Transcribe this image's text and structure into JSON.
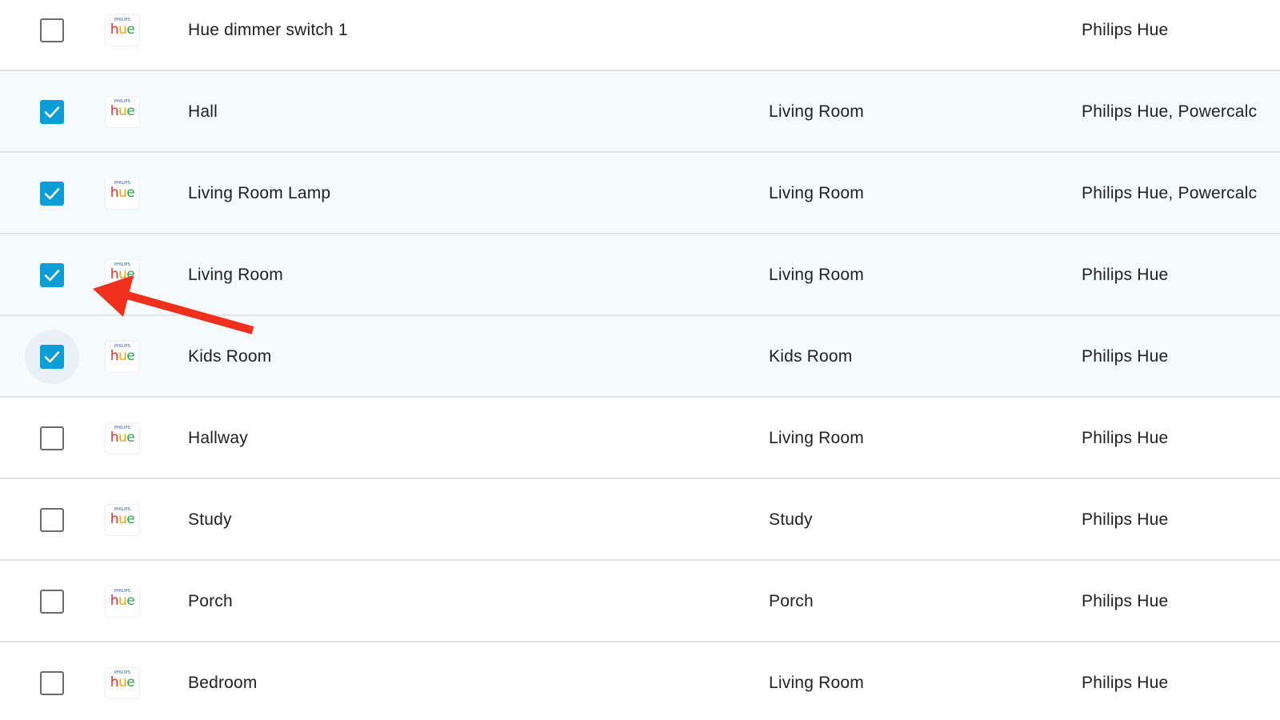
{
  "logo": {
    "brand": "PHILIPS",
    "word_h": "h",
    "word_u": "u",
    "word_e": "e"
  },
  "rows": [
    {
      "name": "Hue dimmer switch 1",
      "area": "",
      "integration": "Philips Hue",
      "checked": false,
      "focused": false
    },
    {
      "name": "Hall",
      "area": "Living Room",
      "integration": "Philips Hue, Powercalc",
      "checked": true,
      "focused": false
    },
    {
      "name": "Living Room Lamp",
      "area": "Living Room",
      "integration": "Philips Hue, Powercalc",
      "checked": true,
      "focused": false
    },
    {
      "name": "Living Room",
      "area": "Living Room",
      "integration": "Philips Hue",
      "checked": true,
      "focused": false
    },
    {
      "name": "Kids Room",
      "area": "Kids Room",
      "integration": "Philips Hue",
      "checked": true,
      "focused": true
    },
    {
      "name": "Hallway",
      "area": "Living Room",
      "integration": "Philips Hue",
      "checked": false,
      "focused": false
    },
    {
      "name": "Study",
      "area": "Study",
      "integration": "Philips Hue",
      "checked": false,
      "focused": false
    },
    {
      "name": "Porch",
      "area": "Porch",
      "integration": "Philips Hue",
      "checked": false,
      "focused": false
    },
    {
      "name": "Bedroom",
      "area": "Living Room",
      "integration": "Philips Hue",
      "checked": false,
      "focused": false
    }
  ],
  "colors": {
    "checkbox_checked": "#0b9dd6",
    "selected_row_bg": "#f5fafd",
    "annotation_arrow": "#f0301c",
    "hue_h": "#e5322d",
    "hue_u": "#f0a51c",
    "hue_e": "#2aa44f"
  },
  "annotation": {
    "type": "arrow",
    "points_to": "checkbox-row-4"
  }
}
